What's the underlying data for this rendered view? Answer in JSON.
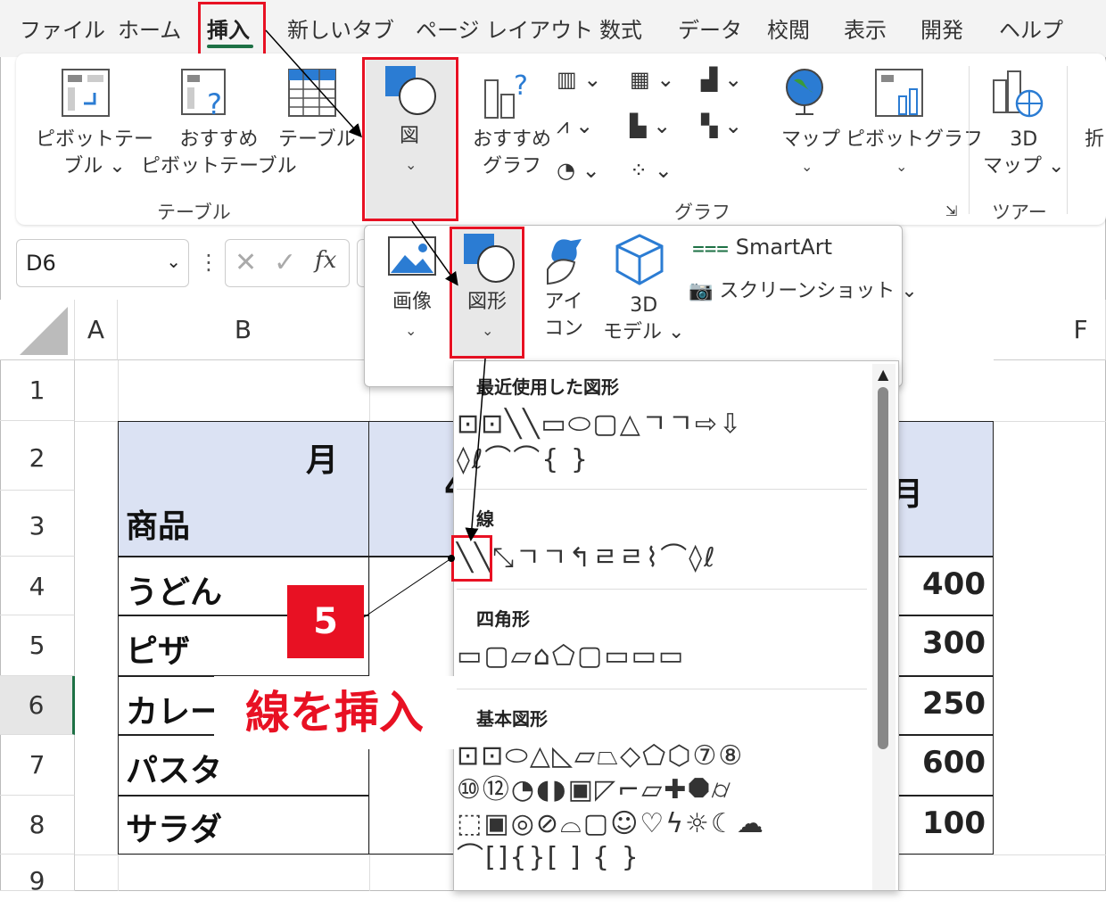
{
  "tabs": [
    "ファイル",
    "ホーム",
    "挿入",
    "新しいタブ",
    "ページ レイアウト",
    "数式",
    "データ",
    "校閲",
    "表示",
    "開発",
    "ヘルプ"
  ],
  "ribbon": {
    "pivot_table": "ピボットテー\nブル ⌄",
    "recommended_pivot": "おすすめ\nピボットテーブル",
    "table": "テーブル",
    "figure": "図",
    "recommended_chart": "おすすめ\nグラフ",
    "map": "マップ",
    "pivot_chart": "ピボットグラフ",
    "map3d": "3D\nマップ ⌄",
    "cut_label": "折",
    "groups": {
      "table": "テーブル",
      "chart": "グラフ",
      "tour": "ツアー"
    }
  },
  "figure_menu": {
    "image": "画像",
    "shapes": "図形",
    "icons": "アイ\nコン",
    "model3d": "3D\nモデル ⌄",
    "smartart": "SmartArt",
    "screenshot": "スクリーンショット ⌄"
  },
  "name_box": "D6",
  "columns": [
    "A",
    "B",
    "F"
  ],
  "rows": [
    "1",
    "2",
    "3",
    "4",
    "5",
    "6",
    "7",
    "8",
    "9"
  ],
  "table": {
    "header_month": "月",
    "header_product": "商品",
    "header_partial_4": "4",
    "header_partial_month": "月",
    "products": [
      "うどん",
      "ピザ",
      "カレー",
      "パスタ",
      "サラダ"
    ],
    "values": [
      "400",
      "300",
      "250",
      "600",
      "100"
    ]
  },
  "shapes_menu": {
    "recent": "最近使用した図形",
    "lines": "線",
    "rectangles": "四角形",
    "basic": "基本図形",
    "recent_row1": "⊡⊡╲╲▭⬭▢△ㄱㄱ⇨⇩",
    "recent_row2": "◊ℓ⌒⌒{ }",
    "lines_row": "╲╲⤡ㄱㄱ↰ㄹㄹ⌇⌒◊ℓ",
    "rect_row": "▭▢▱⌂⬠▢▭▭▭",
    "basic_row1": "⊡⊡⬭△◺▱⏢◇⬠⬡⑦⑧",
    "basic_row2": "⑩⑫◔◖◗▣◸⌐▱✚⯃⌭",
    "basic_row3": "⬚▣◎⊘⌓▢☺♡ϟ☼☾☁",
    "basic_row4": "⌒[]{}[ ] { }"
  },
  "callout": {
    "step": "5",
    "label": "線を挿入"
  }
}
